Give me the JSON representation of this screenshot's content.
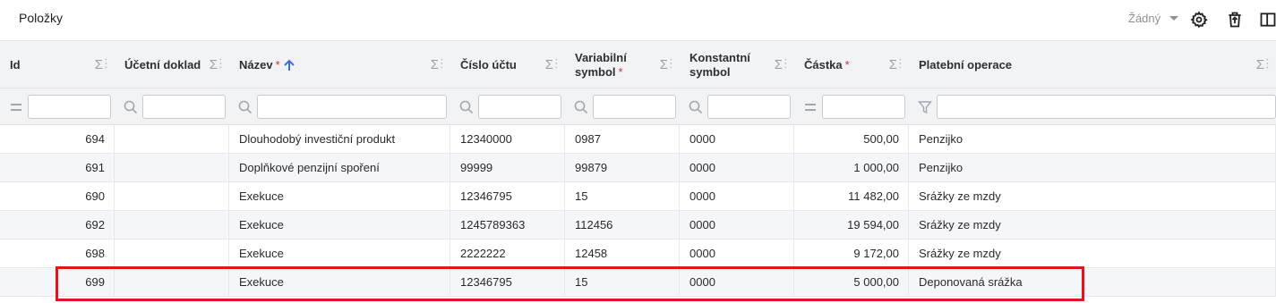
{
  "toolbar": {
    "title": "Položky",
    "view_selector": "Žádný",
    "settings_icon": "gear-icon",
    "delete_icon": "trash-icon",
    "layout_icon": "columns-icon"
  },
  "columns": [
    {
      "label": "Id",
      "required": false,
      "sorted": false
    },
    {
      "label": "Účetní doklad",
      "required": false,
      "sorted": false
    },
    {
      "label": "Název",
      "required": true,
      "sorted": true
    },
    {
      "label": "Číslo účtu",
      "required": false,
      "sorted": false
    },
    {
      "label": "Variabilní symbol",
      "required": true,
      "sorted": false
    },
    {
      "label": "Konstantní symbol",
      "required": false,
      "sorted": false
    },
    {
      "label": "Částka",
      "required": true,
      "sorted": false
    },
    {
      "label": "Platební operace",
      "required": false,
      "sorted": false
    }
  ],
  "required_marker": "*",
  "aggregate_symbol": "Σ",
  "menu_symbol": "⋮",
  "filters": [
    {
      "icon": "equals-icon",
      "value": ""
    },
    {
      "icon": "search-icon",
      "value": ""
    },
    {
      "icon": "search-icon",
      "value": ""
    },
    {
      "icon": "search-icon",
      "value": ""
    },
    {
      "icon": "search-icon",
      "value": ""
    },
    {
      "icon": "search-icon",
      "value": ""
    },
    {
      "icon": "equals-icon",
      "value": ""
    },
    {
      "icon": "filter-icon",
      "value": ""
    }
  ],
  "rows": [
    {
      "id": "694",
      "doklad": "",
      "nazev": "Dlouhodobý investiční produkt",
      "ucet": "12340000",
      "vs": "0987",
      "ks": "0000",
      "castka": "500,00",
      "operace": "Penzijko"
    },
    {
      "id": "691",
      "doklad": "",
      "nazev": "Doplňkové penzijní spoření",
      "ucet": "99999",
      "vs": "99879",
      "ks": "0000",
      "castka": "1 000,00",
      "operace": "Penzijko"
    },
    {
      "id": "690",
      "doklad": "",
      "nazev": "Exekuce",
      "ucet": "12346795",
      "vs": "15",
      "ks": "0000",
      "castka": "11 482,00",
      "operace": "Srážky ze mzdy"
    },
    {
      "id": "692",
      "doklad": "",
      "nazev": "Exekuce",
      "ucet": "1245789363",
      "vs": "112456",
      "ks": "0000",
      "castka": "19 594,00",
      "operace": "Srážky ze mzdy"
    },
    {
      "id": "698",
      "doklad": "",
      "nazev": "Exekuce",
      "ucet": "2222222",
      "vs": "12458",
      "ks": "0000",
      "castka": "9 172,00",
      "operace": "Srážky ze mzdy"
    },
    {
      "id": "699",
      "doklad": "",
      "nazev": "Exekuce",
      "ucet": "12346795",
      "vs": "15",
      "ks": "0000",
      "castka": "5 000,00",
      "operace": "Deponovaná srážka"
    }
  ],
  "highlighted_row_id": "699",
  "colors": {
    "accent": "#3b6fd8",
    "required": "#d32f2f",
    "highlight": "#e0161f"
  }
}
